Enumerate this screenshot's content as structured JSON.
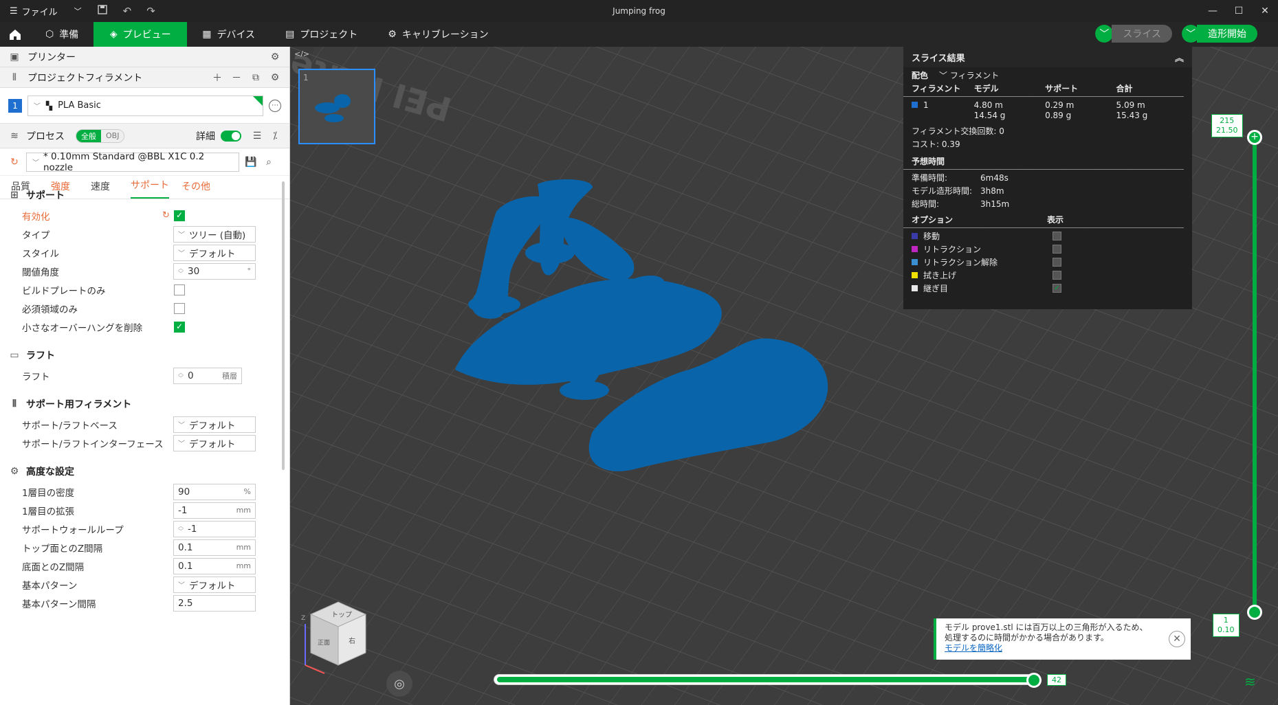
{
  "titlebar": {
    "file_menu": "ファイル",
    "window_title": "Jumping frog",
    "icons": [
      "hamburger-icon",
      "chevron-down-icon",
      "save-icon",
      "undo-icon",
      "redo-icon",
      "minimize-icon",
      "maximize-icon",
      "close-icon"
    ]
  },
  "nav": {
    "tabs": [
      {
        "label": "準備",
        "icon": "cube-icon"
      },
      {
        "label": "プレビュー",
        "icon": "preview-icon",
        "active": true
      },
      {
        "label": "デバイス",
        "icon": "device-icon"
      },
      {
        "label": "プロジェクト",
        "icon": "project-icon"
      },
      {
        "label": "キャリブレーション",
        "icon": "calibration-icon"
      }
    ],
    "slice_label": "スライス",
    "print_label": "造形開始",
    "accent": "#00ae42"
  },
  "printer": {
    "label": "プリンター"
  },
  "filament": {
    "header": "プロジェクトフィラメント",
    "index": "1",
    "name": "PLA Basic",
    "color": "#1e6fd0"
  },
  "process": {
    "label": "プロセス",
    "global_label": "全般",
    "obj_label": "OBJ",
    "detail_label": "詳細",
    "preset": "* 0.10mm Standard @BBL X1C 0.2 nozzle",
    "tabs": [
      "品質",
      "強度",
      "速度",
      "サポート",
      "その他"
    ]
  },
  "settings": {
    "support": {
      "title": "サポート",
      "enable": "有効化",
      "type_label": "タイプ",
      "type_value": "ツリー (自動)",
      "style_label": "スタイル",
      "style_value": "デフォルト",
      "threshold_label": "閾値角度",
      "threshold_value": "30",
      "threshold_unit": "°",
      "buildplate_only": "ビルドプレートのみ",
      "critical_only": "必須領域のみ",
      "remove_small": "小さなオーバーハングを削除"
    },
    "raft": {
      "title": "ラフト",
      "raft_label": "ラフト",
      "raft_value": "0",
      "raft_unit": "積層"
    },
    "support_filament": {
      "title": "サポート用フィラメント",
      "base_label": "サポート/ラフトベース",
      "base_value": "デフォルト",
      "interface_label": "サポート/ラフトインターフェース",
      "interface_value": "デフォルト"
    },
    "advanced": {
      "title": "高度な設定",
      "density_label": "1層目の密度",
      "density_value": "90",
      "density_unit": "%",
      "expansion_label": "1層目の拡張",
      "expansion_value": "-1",
      "expansion_unit": "mm",
      "wall_label": "サポートウォールループ",
      "wall_value": "-1",
      "top_z_label": "トップ面とのZ間隔",
      "top_z_value": "0.1",
      "top_z_unit": "mm",
      "bottom_z_label": "底面とのZ間隔",
      "bottom_z_value": "0.1",
      "bottom_z_unit": "mm",
      "pattern_label": "基本パターン",
      "pattern_value": "デフォルト",
      "pattern_spacing_label": "基本パターン間隔",
      "pattern_spacing_value": "2.5"
    }
  },
  "viewport": {
    "plate_text": "PEI Plate",
    "thumb_index": "1",
    "cube_labels": {
      "top": "トップ",
      "front": "正面",
      "right": "右",
      "z": "Z"
    },
    "model_color": "#0a64aa"
  },
  "results": {
    "title": "スライス結果",
    "color_scheme_label": "配色",
    "color_scheme_value": "フィラメント",
    "columns": [
      "フィラメント",
      "モデル",
      "サポート",
      "合計"
    ],
    "row": {
      "id": "1",
      "model_len": "4.80 m",
      "model_g": "14.54 g",
      "support_len": "0.29 m",
      "support_g": "0.89 g",
      "total_len": "5.09 m",
      "total_g": "15.43 g"
    },
    "swaps": "フィラメント交換回数:  0",
    "cost": "コスト:  0.39",
    "time_title": "予想時間",
    "times": [
      {
        "label": "準備時間:",
        "value": "6m48s"
      },
      {
        "label": "モデル造形時間:",
        "value": "3h8m"
      },
      {
        "label": "総時間:",
        "value": "3h15m"
      }
    ],
    "options_title": "オプション",
    "display_title": "表示",
    "options": [
      {
        "label": "移動",
        "color": "#3a3aa8",
        "checked": false
      },
      {
        "label": "リトラクション",
        "color": "#c026c0",
        "checked": false
      },
      {
        "label": "リトラクション解除",
        "color": "#3a8fd0",
        "checked": false
      },
      {
        "label": "拭き上げ",
        "color": "#f0e000",
        "checked": false
      },
      {
        "label": "継ぎ目",
        "color": "#e8e8e8",
        "checked": true
      }
    ]
  },
  "layer_slider": {
    "top_layer": "215",
    "top_height": "21.50",
    "bottom_layer": "1",
    "bottom_height": "0.10"
  },
  "move_slider": {
    "value": "42",
    "fraction": 1.0
  },
  "notification": {
    "line1": "モデル prove1.stl には百万以上の三角形が入るため、",
    "line2": "処理するのに時間がかかる場合があります。",
    "link": "モデルを簡略化"
  }
}
